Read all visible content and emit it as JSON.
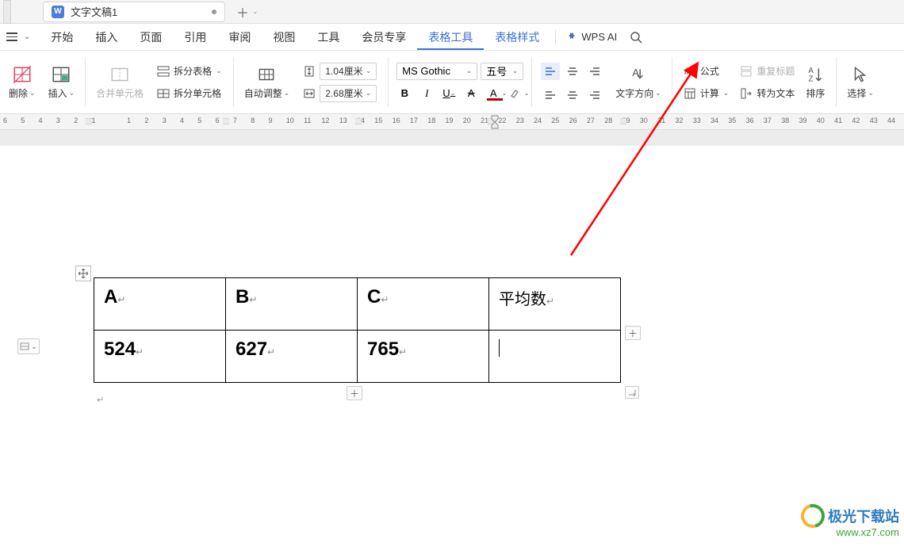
{
  "titlebar": {
    "doc_badge": "W",
    "doc_title": "文字文稿1"
  },
  "menubar": {
    "items": [
      "开始",
      "插入",
      "页面",
      "引用",
      "审阅",
      "视图",
      "工具",
      "会员专享",
      "表格工具",
      "表格样式"
    ],
    "active_index": 8,
    "link_indices": [
      8,
      9
    ],
    "ai_label": "WPS AI"
  },
  "ribbon": {
    "delete_label": "删除",
    "insert_label": "插入",
    "merge_cells": "合并单元格",
    "split_table": "拆分表格",
    "split_cells": "拆分单元格",
    "auto_adjust": "自动调整",
    "row_height": "1.04厘米",
    "col_width": "2.68厘米",
    "font_name": "MS Gothic",
    "font_size": "五号",
    "text_direction": "文字方向",
    "formula": "公式",
    "calculate": "计算",
    "repeat_header": "重复标题",
    "convert_text": "转为文本",
    "sort": "排序",
    "select": "选择"
  },
  "ruler": {
    "numbers": [
      "6",
      "5",
      "4",
      "3",
      "2",
      "1",
      "",
      "1",
      "2",
      "3",
      "4",
      "5",
      "6",
      "7",
      "8",
      "9",
      "10",
      "11",
      "12",
      "13",
      "14",
      "15",
      "16",
      "17",
      "18",
      "19",
      "20",
      "21",
      "22",
      "23",
      "24",
      "25",
      "26",
      "27",
      "28",
      "29",
      "30",
      "31",
      "32",
      "33",
      "34",
      "35",
      "36",
      "37",
      "38",
      "39",
      "40",
      "41",
      "42",
      "43",
      "44"
    ]
  },
  "table": {
    "headers": [
      "A",
      "B",
      "C",
      "平均数"
    ],
    "row1": [
      "524",
      "627",
      "765",
      ""
    ]
  },
  "watermark": {
    "name": "极光下载站",
    "url": "www.xz7.com"
  }
}
